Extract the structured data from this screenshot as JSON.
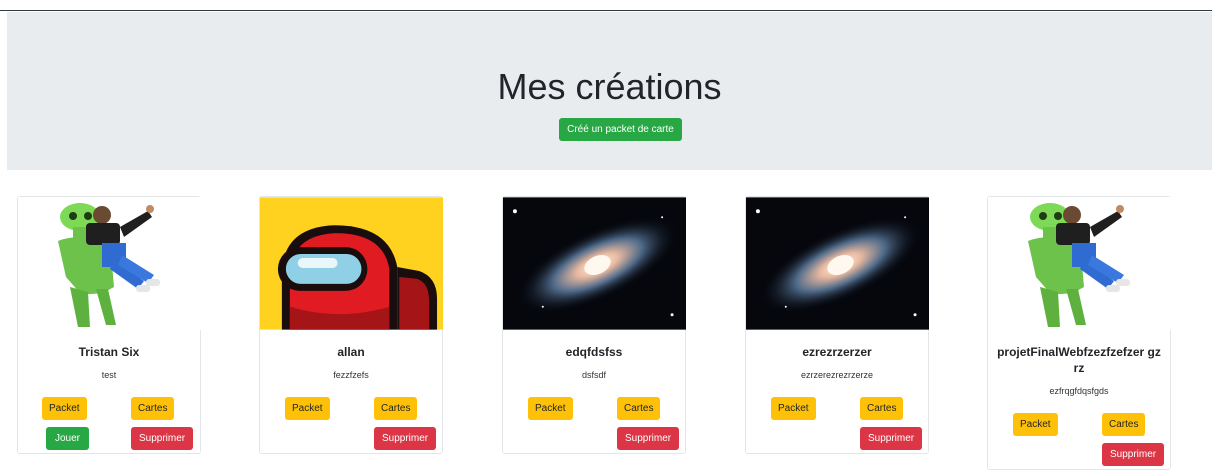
{
  "header": {
    "title": "Mes créations",
    "create_button": "Créé un packet de carte"
  },
  "cards": [
    {
      "title": "Tristan Six",
      "description": "test",
      "image": "alien-costume-image",
      "packet_label": "Packet",
      "cartes_label": "Cartes",
      "jouer_label": "Jouer",
      "supprimer_label": "Supprimer"
    },
    {
      "title": "allan",
      "description": "fezzfzefs",
      "image": "among-us-image",
      "packet_label": "Packet",
      "cartes_label": "Cartes",
      "supprimer_label": "Supprimer"
    },
    {
      "title": "edqfdsfss",
      "description": "dsfsdf",
      "image": "galaxy-image",
      "packet_label": "Packet",
      "cartes_label": "Cartes",
      "supprimer_label": "Supprimer"
    },
    {
      "title": "ezrezrzerzer",
      "description": "ezrzerezrezrzerze",
      "image": "galaxy-image",
      "packet_label": "Packet",
      "cartes_label": "Cartes",
      "supprimer_label": "Supprimer"
    },
    {
      "title": "projetFinalWebfzezfzefzer gzrz",
      "description": "ezfrqgfdqsfgds",
      "image": "alien-costume-image",
      "packet_label": "Packet",
      "cartes_label": "Cartes",
      "supprimer_label": "Supprimer"
    }
  ],
  "colors": {
    "jumbotron": "#e9ecef",
    "success": "#28a745",
    "warning": "#ffc107",
    "danger": "#dc3545"
  }
}
